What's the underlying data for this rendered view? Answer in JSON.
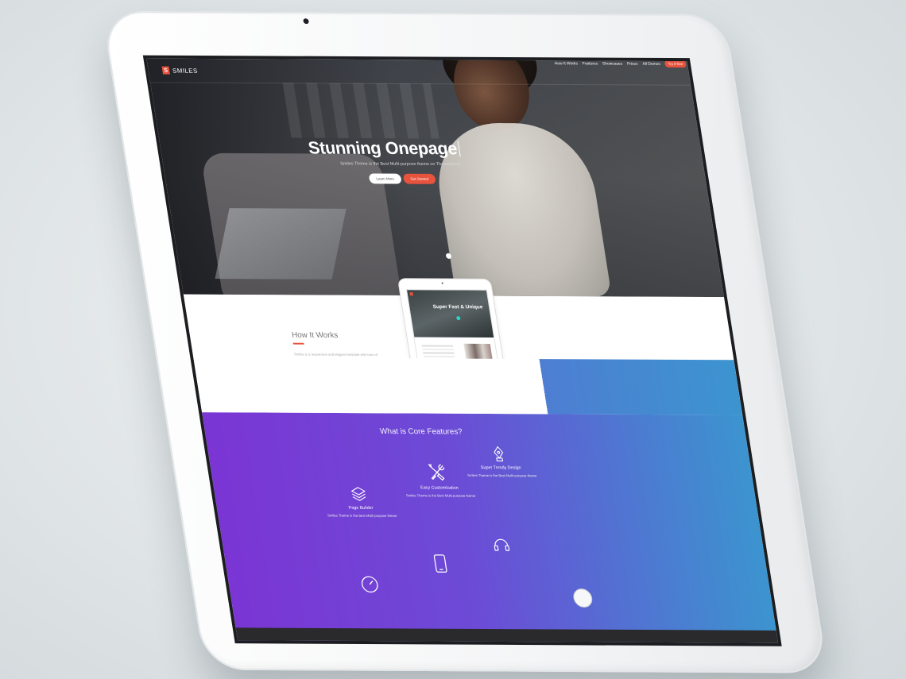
{
  "logo": {
    "mark": "S",
    "text": "SMILES"
  },
  "nav": {
    "links": [
      "How It Works",
      "Features",
      "Showcases",
      "Prices",
      "All Demos"
    ],
    "cta": "Try it free"
  },
  "hero": {
    "title": "Stunning Onepage",
    "subtitle": "Smiles Theme is the Best Multi-purpose theme on Themeforest",
    "learn_more": "Learn More",
    "get_started": "Get Started"
  },
  "how": {
    "title": "How It Works",
    "text": "Smiles is a responsive and elegant template with tons of features. Lorem ipsum dolor sit amet, consectetur. Ut et this perfect solution. Ut enim ad minim veniam, quis nostrud exercitation."
  },
  "mini_tablet": {
    "title": "Super Fast & Unique"
  },
  "features": {
    "title": "What is Core Features?",
    "items": [
      {
        "name": "Page Builder",
        "desc": "Smiles Theme is the Best Multi-purpose theme",
        "icon": "layers-icon"
      },
      {
        "name": "Easy Customization",
        "desc": "Smiles Theme is the Best Multi-purpose theme",
        "icon": "tools-icon"
      },
      {
        "name": "Super Trendy Design",
        "desc": "Smiles Theme is the Best Multi-purpose theme",
        "icon": "pen-nib-icon"
      }
    ]
  },
  "colors": {
    "accent": "#e8533e",
    "teal": "#2fd4c2",
    "purple": "#7b35d4",
    "blue": "#3c94cf"
  }
}
